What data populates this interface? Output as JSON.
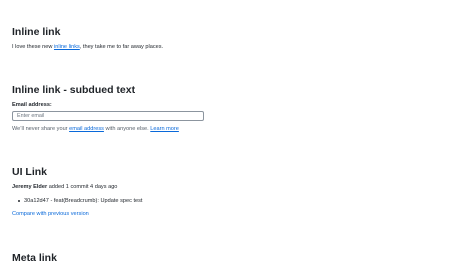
{
  "sections": {
    "inline_link": {
      "heading": "Inline link",
      "text_before": "I love these new ",
      "link_text": "inline links",
      "text_after": ", they take me to far away places."
    },
    "subdued": {
      "heading": "Inline link - subdued text",
      "label": "Email address:",
      "input_placeholder": "Enter email",
      "note_before": "We’ll never share your ",
      "note_link": "email address",
      "note_middle": " with anyone else. ",
      "note_learn_more": "Learn more"
    },
    "ui_link": {
      "heading": "UI Link",
      "author": "Jeremy Elder",
      "activity": " added 1 commit 4 days ago",
      "commit_sha": "30a12d47",
      "commit_message": " - feat(Breadcrumb): Update spec test",
      "compare_link": "Compare with previous version"
    },
    "meta_link": {
      "heading": "Meta link"
    }
  }
}
